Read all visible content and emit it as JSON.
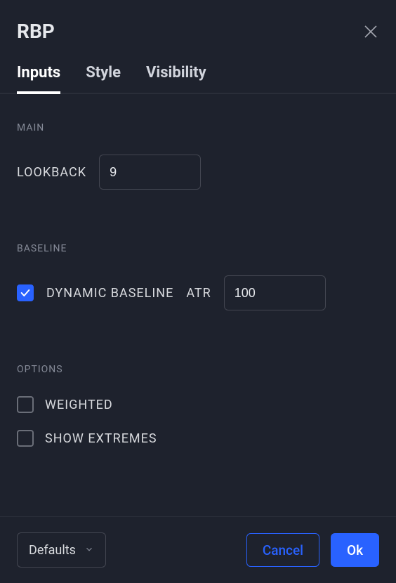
{
  "header": {
    "title": "RBP"
  },
  "tabs": {
    "items": [
      {
        "label": "Inputs",
        "active": true
      },
      {
        "label": "Style",
        "active": false
      },
      {
        "label": "Visibility",
        "active": false
      }
    ]
  },
  "sections": {
    "main": {
      "heading": "MAIN",
      "lookback_label": "LOOKBACK",
      "lookback_value": "9"
    },
    "baseline": {
      "heading": "BASELINE",
      "dynamic_label": "DYNAMIC BASELINE",
      "dynamic_checked": true,
      "atr_label": "ATR",
      "atr_value": "100"
    },
    "options": {
      "heading": "OPTIONS",
      "weighted_label": "WEIGHTED",
      "weighted_checked": false,
      "show_extremes_label": "SHOW EXTREMES",
      "show_extremes_checked": false
    }
  },
  "footer": {
    "defaults_label": "Defaults",
    "cancel_label": "Cancel",
    "ok_label": "Ok"
  }
}
